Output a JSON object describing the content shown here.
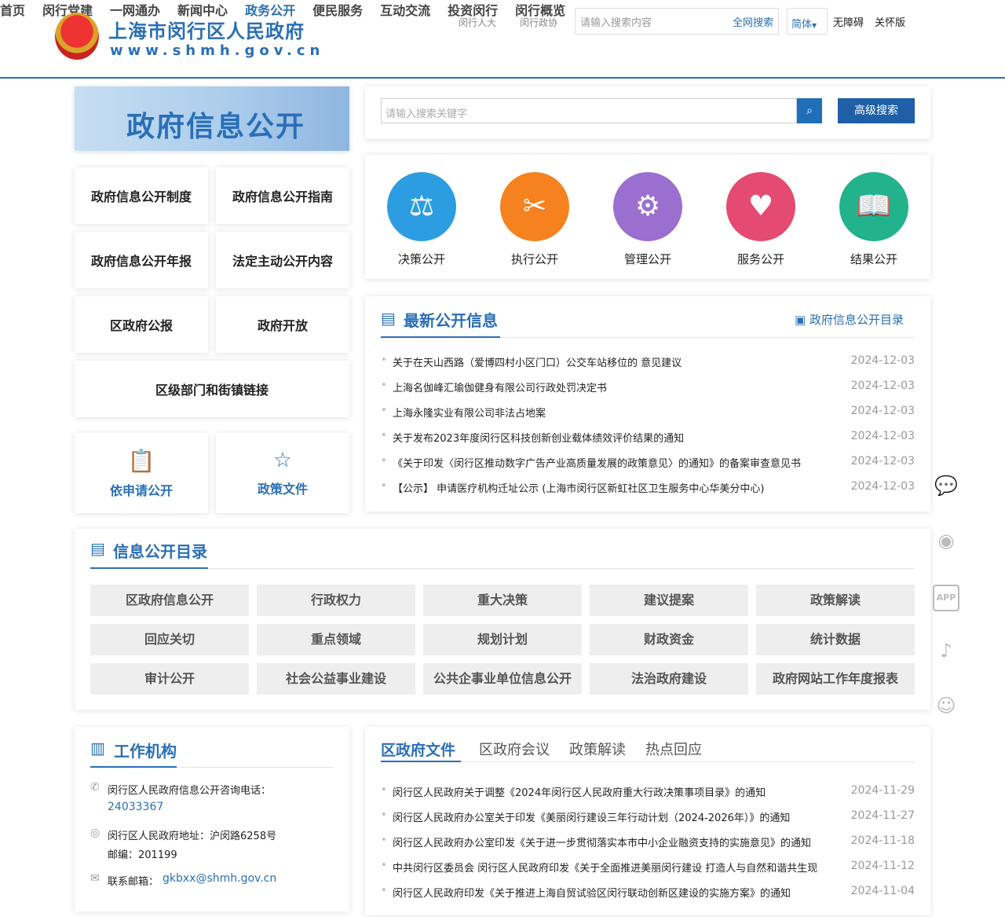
{
  "header": {
    "site_title": "上海市闵行区人民政府",
    "site_url": "www.shmh.gov.cn",
    "top_links": [
      "闵行人大",
      "闵行政协"
    ],
    "search_placeholder": "请输入搜索内容",
    "search_button": "全网搜索",
    "lang": "简体",
    "accessibility": "无障碍",
    "care": "关怀版",
    "nav": [
      "首页",
      "闵行党建",
      "一网通办",
      "新闻中心",
      "政务公开",
      "便民服务",
      "互动交流",
      "投资闵行",
      "闵行概览"
    ]
  },
  "banner": "政府信息公开",
  "search": {
    "placeholder": "请输入搜索关键字",
    "advanced": "高级搜索"
  },
  "left_cards": [
    "政府信息公开制度",
    "政府信息公开指南",
    "政府信息公开年报",
    "法定主动公开内容",
    "区政府公报",
    "政府开放",
    "区级部门和街镇链接"
  ],
  "icon_cards": [
    "依申请公开",
    "政策文件"
  ],
  "categories": [
    {
      "label": "决策公开",
      "color": "#2d9de2"
    },
    {
      "label": "执行公开",
      "color": "#f5821f"
    },
    {
      "label": "管理公开",
      "color": "#9b6fd0"
    },
    {
      "label": "服务公开",
      "color": "#e44a72"
    },
    {
      "label": "结果公开",
      "color": "#22b38c"
    }
  ],
  "latest": {
    "title": "最新公开信息",
    "catalog_link": "政府信息公开目录",
    "items": [
      {
        "t": "关于在天山西路（爱博四村小区门口）公交车站移位的 意见建议",
        "d": "2024-12-03"
      },
      {
        "t": "上海名伽峰汇瑜伽健身有限公司行政处罚决定书",
        "d": "2024-12-03"
      },
      {
        "t": "上海永隆实业有限公司非法占地案",
        "d": "2024-12-03"
      },
      {
        "t": "关于发布2023年度闵行区科技创新创业载体绩效评价结果的通知",
        "d": "2024-12-03"
      },
      {
        "t": "《关于印发〈闵行区推动数字广告产业高质量发展的政策意见〉的通知》的备案审查意见书",
        "d": "2024-12-03"
      },
      {
        "t": "【公示】 申请医疗机构迁址公示 (上海市闵行区新虹社区卫生服务中心华美分中心)",
        "d": "2024-12-03"
      }
    ]
  },
  "catalog": {
    "title": "信息公开目录",
    "items": [
      "区政府信息公开",
      "行政权力",
      "重大决策",
      "建议提案",
      "政策解读",
      "回应关切",
      "重点领域",
      "规划计划",
      "财政资金",
      "统计数据",
      "审计公开",
      "社会公益事业建设",
      "公共企事业单位信息公开",
      "法治政府建设",
      "政府网站工作年度报表"
    ]
  },
  "work": {
    "title": "工作机构",
    "phone_label": "闵行区人民政府信息公开咨询电话：",
    "phone": "24033367",
    "address": "闵行区人民政府地址：沪闵路6258号",
    "postcode": "邮编：201199",
    "email_label": "联系邮箱：",
    "email": "gkbxx@shmh.gov.cn"
  },
  "docs": {
    "tabs": [
      "区政府文件",
      "区政府会议",
      "政策解读",
      "热点回应"
    ],
    "items": [
      {
        "t": "闵行区人民政府关于调整《2024年闵行区人民政府重大行政决策事项目录》的通知",
        "d": "2024-11-29"
      },
      {
        "t": "闵行区人民政府办公室关于印发《美丽闵行建设三年行动计划（2024-2026年）》的通知",
        "d": "2024-11-27"
      },
      {
        "t": "闵行区人民政府办公室印发《关于进一步贯彻落实本市中小企业融资支持的实施意见》的通知",
        "d": "2024-11-18"
      },
      {
        "t": "中共闵行区委员会 闵行区人民政府印发《关于全面推进美丽闵行建设 打造人与自然和谐共生现",
        "d": "2024-11-12"
      },
      {
        "t": "闵行区人民政府印发《关于推进上海自贸试验区闵行联动创新区建设的实施方案》的通知",
        "d": "2024-11-04"
      }
    ]
  },
  "side": {
    "app": "APP"
  }
}
